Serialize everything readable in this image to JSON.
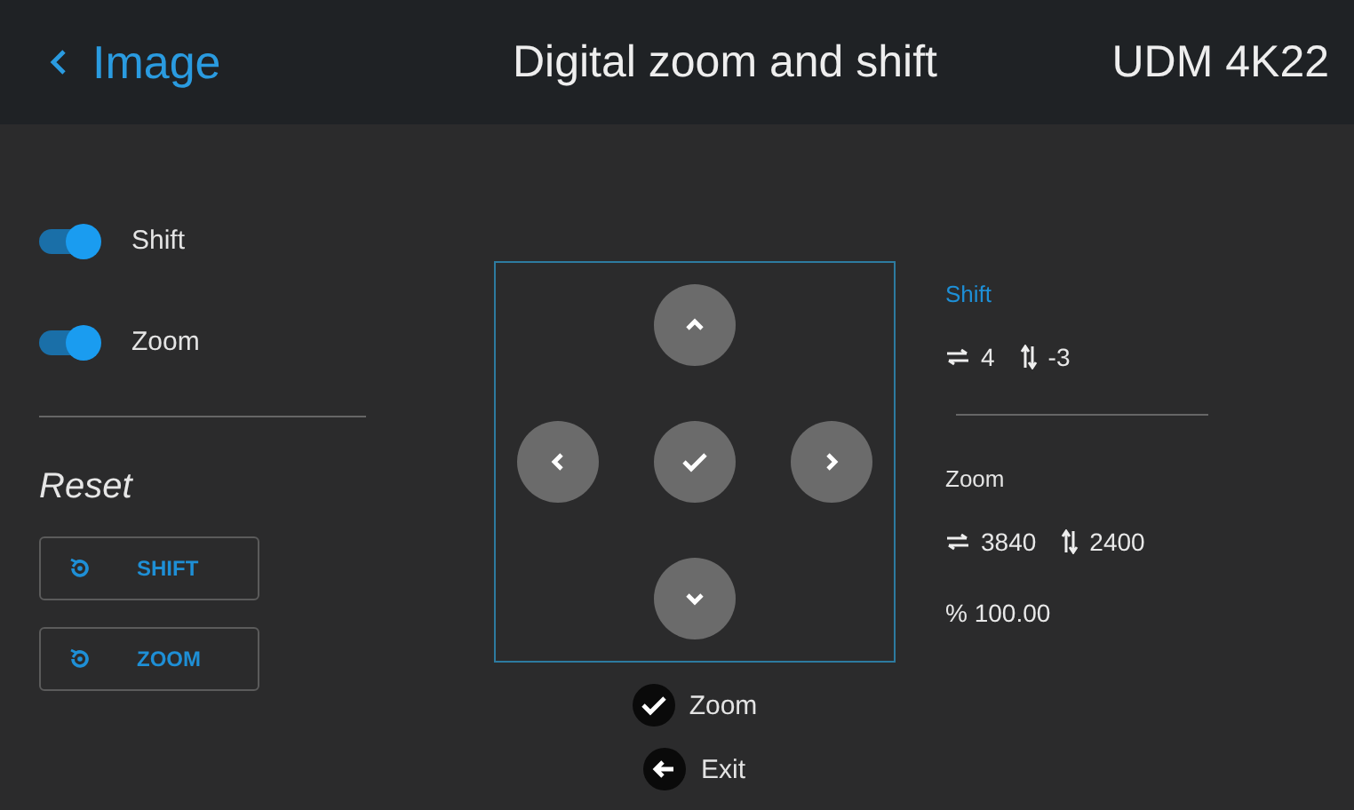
{
  "header": {
    "back_label": "Image",
    "title": "Digital zoom and shift",
    "model": "UDM 4K22"
  },
  "toggles": [
    {
      "label": "Shift",
      "on": true
    },
    {
      "label": "Zoom",
      "on": true
    }
  ],
  "reset": {
    "title": "Reset",
    "buttons": [
      "SHIFT",
      "ZOOM"
    ]
  },
  "pad": [
    {
      "kind": "up"
    },
    {
      "kind": "left"
    },
    {
      "kind": "ok"
    },
    {
      "kind": "right"
    },
    {
      "kind": "down"
    }
  ],
  "hints": [
    {
      "kind": "check",
      "label": "Zoom"
    },
    {
      "kind": "back",
      "label": "Exit"
    }
  ],
  "shift": {
    "title": "Shift",
    "horizontal": "4",
    "vertical": "-3"
  },
  "zoom": {
    "title": "Zoom",
    "horizontal": "3840",
    "vertical": "2400",
    "percent": "% 100.00"
  }
}
